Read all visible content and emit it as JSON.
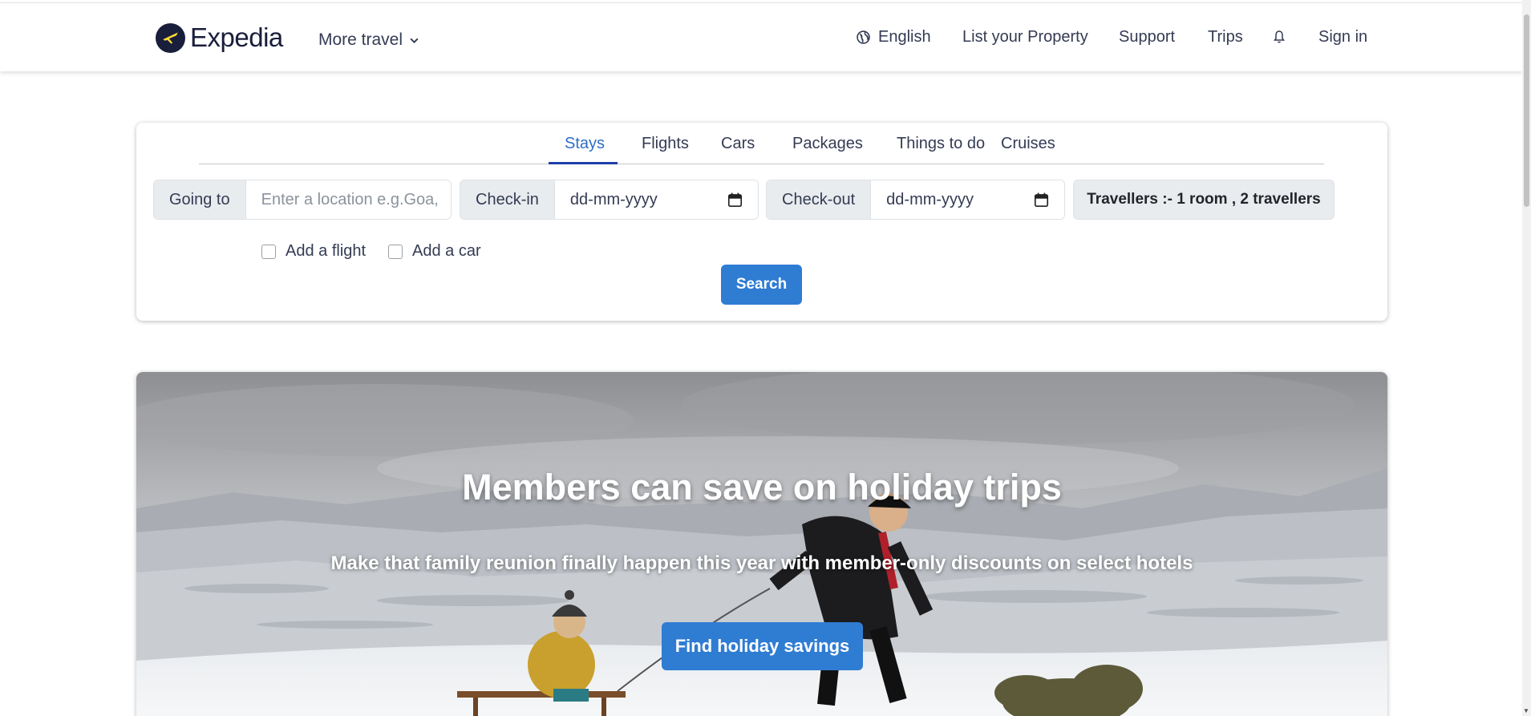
{
  "header": {
    "logo_text": "Expedia",
    "more_travel": "More travel",
    "nav": {
      "language": "English",
      "list_property": "List your Property",
      "support": "Support",
      "trips": "Trips",
      "sign_in": "Sign in"
    }
  },
  "search": {
    "tabs": [
      {
        "label": "Stays",
        "active": true
      },
      {
        "label": "Flights",
        "active": false
      },
      {
        "label": "Cars",
        "active": false
      },
      {
        "label": "Packages",
        "active": false
      },
      {
        "label": "Things to do",
        "active": false
      },
      {
        "label": "Cruises",
        "active": false
      }
    ],
    "going_to_label": "Going to",
    "going_to_placeholder": "Enter a location e.g.Goa,",
    "check_in_label": "Check-in",
    "check_in_value": "dd-mm-yyyy",
    "check_out_label": "Check-out",
    "check_out_value": "dd-mm-yyyy",
    "travellers": "Travellers :- 1 room , 2 travellers",
    "add_flight": "Add a flight",
    "add_car": "Add a car",
    "search_button": "Search"
  },
  "hero": {
    "title": "Members can save on holiday trips",
    "subtitle": "Make that family reunion finally happen this year with member-only discounts on select hotels",
    "button": "Find holiday savings"
  },
  "colors": {
    "brand_navy": "#191e3b",
    "accent_blue": "#2f7cd3",
    "active_tab": "#2f6ec5"
  }
}
